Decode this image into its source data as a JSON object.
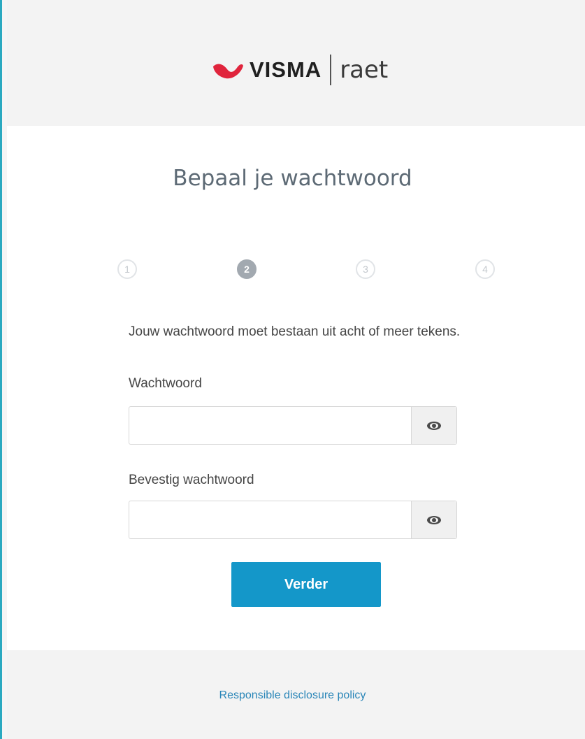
{
  "brand": {
    "logo_primary": "VISMA",
    "logo_secondary": "raet",
    "mark_color": "#e0243c"
  },
  "page": {
    "title": "Bepaal je wachtwoord"
  },
  "steps": [
    {
      "label": "1",
      "active": false
    },
    {
      "label": "2",
      "active": true
    },
    {
      "label": "3",
      "active": false
    },
    {
      "label": "4",
      "active": false
    }
  ],
  "form": {
    "hint": "Jouw wachtwoord moet bestaan uit acht of meer tekens.",
    "password": {
      "label": "Wachtwoord",
      "value": "",
      "placeholder": "",
      "toggle_icon": "eye-icon"
    },
    "confirm_password": {
      "label": "Bevestig wachtwoord",
      "value": "",
      "placeholder": "",
      "toggle_icon": "eye-icon"
    },
    "submit_label": "Verder"
  },
  "footer": {
    "link_label": "Responsible disclosure policy"
  },
  "colors": {
    "accent": "#1497c9",
    "left_bar": "#2aa9c0",
    "link": "#2a86b8"
  }
}
